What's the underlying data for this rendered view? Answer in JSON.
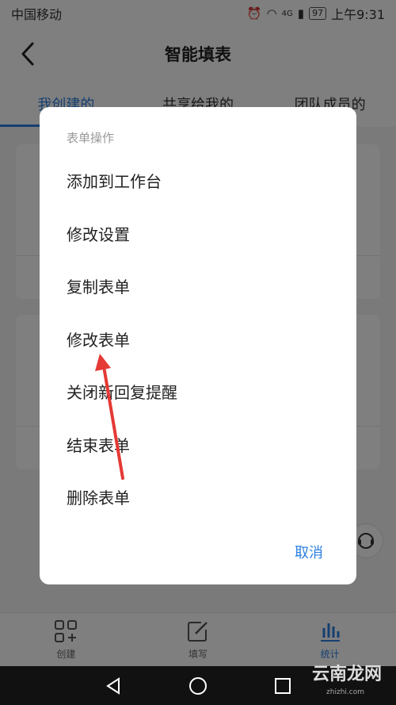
{
  "status_bar": {
    "carrier": "中国移动",
    "battery": "97",
    "time": "上午9:31",
    "network": "4G"
  },
  "header": {
    "title": "智能填表"
  },
  "tabs": [
    {
      "label": "我创建的",
      "active": true
    },
    {
      "label": "共享给我的",
      "active": false
    },
    {
      "label": "团队成员的",
      "active": false
    }
  ],
  "bottom_nav": [
    {
      "label": "创建",
      "icon": "grid-plus-icon",
      "active": false
    },
    {
      "label": "填写",
      "icon": "edit-icon",
      "active": false
    },
    {
      "label": "统计",
      "icon": "bar-chart-icon",
      "active": true
    }
  ],
  "dialog": {
    "title": "表单操作",
    "items": [
      "添加到工作台",
      "修改设置",
      "复制表单",
      "修改表单",
      "关闭新回复提醒",
      "结束表单",
      "删除表单"
    ],
    "cancel_label": "取消"
  },
  "watermark": {
    "text": "云南龙网",
    "sub": "zhizhi.com"
  },
  "colors": {
    "accent": "#2b7fe0",
    "overlay": "rgba(0,0,0,0.5)",
    "arrow": "#e53935"
  }
}
